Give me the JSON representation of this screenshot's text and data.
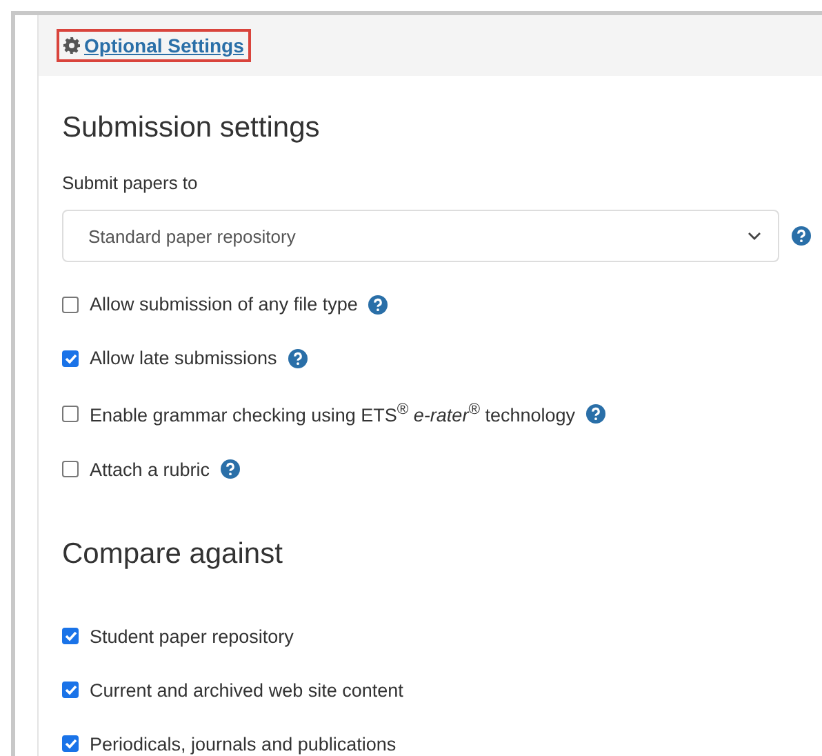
{
  "header_link": {
    "label": "Optional Settings",
    "highlighted": true
  },
  "sections": [
    {
      "title": "Submission settings",
      "field_label": "Submit papers to",
      "select": {
        "value": "Standard paper repository",
        "help": true
      },
      "options": [
        {
          "label": "Allow submission of any file type",
          "checked": false,
          "help": true
        },
        {
          "label": "Allow late submissions",
          "checked": true,
          "help": true
        },
        {
          "label": "Enable grammar checking using ETS$^{®}$ *e-rater*$^{®}$ technology",
          "checked": false,
          "help": true
        },
        {
          "label": "Attach a rubric",
          "checked": false,
          "help": true
        }
      ]
    },
    {
      "title": "Compare against",
      "options": [
        {
          "label": "Student paper repository",
          "checked": true,
          "help": false
        },
        {
          "label": "Current and archived web site content",
          "checked": true,
          "help": false
        },
        {
          "label": "Periodicals, journals and publications",
          "checked": true,
          "help": false
        }
      ]
    }
  ]
}
